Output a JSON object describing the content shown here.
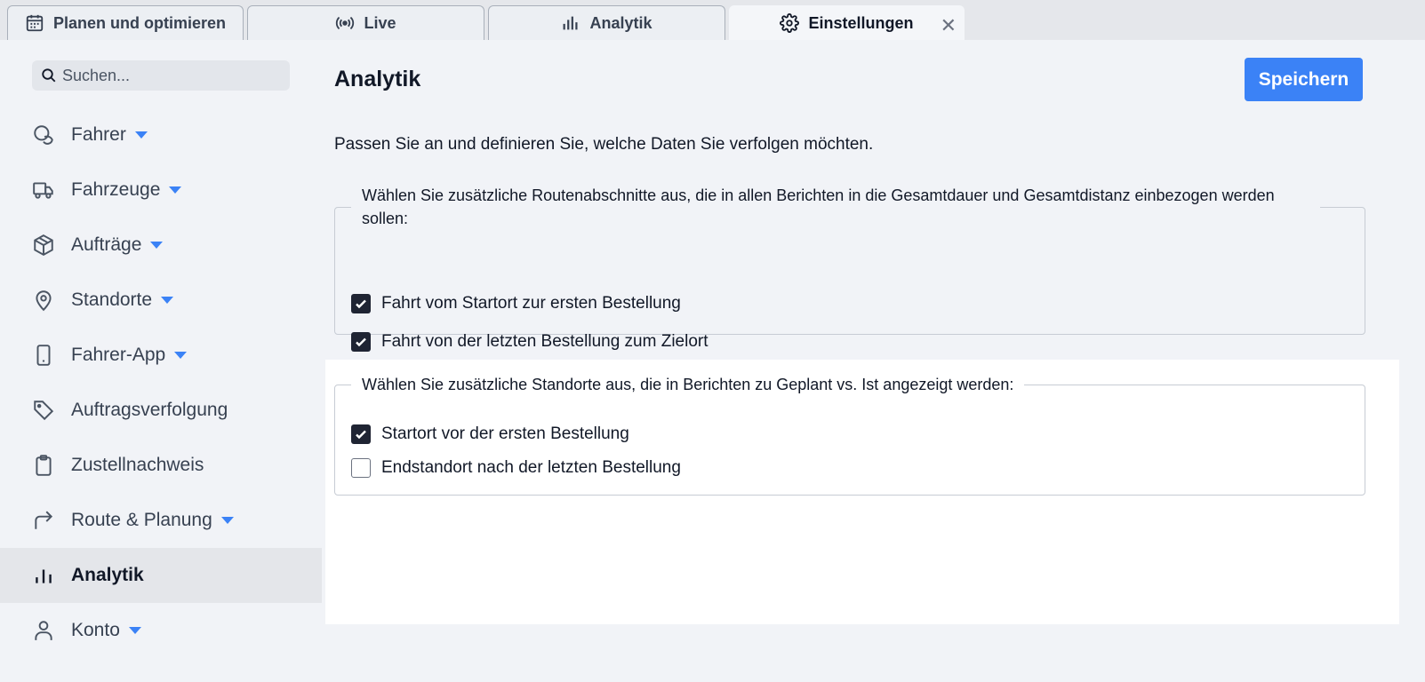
{
  "tabs": [
    {
      "label": "Planen und optimieren",
      "icon": "calendar-icon"
    },
    {
      "label": "Live",
      "icon": "broadcast-icon"
    },
    {
      "label": "Analytik",
      "icon": "bar-chart-icon"
    },
    {
      "label": "Einstellungen",
      "icon": "gear-icon",
      "active": true,
      "close": "✕"
    }
  ],
  "search": {
    "placeholder": "Suchen..."
  },
  "sidebar": {
    "items": [
      {
        "label": "Fahrer",
        "icon": "drivers-icon",
        "expandable": true
      },
      {
        "label": "Fahrzeuge",
        "icon": "truck-icon",
        "expandable": true
      },
      {
        "label": "Aufträge",
        "icon": "package-icon",
        "expandable": true
      },
      {
        "label": "Standorte",
        "icon": "location-pin-icon",
        "expandable": true
      },
      {
        "label": "Fahrer-App",
        "icon": "smartphone-icon",
        "expandable": true
      },
      {
        "label": "Auftragsverfolgung",
        "icon": "tag-icon",
        "expandable": false
      },
      {
        "label": "Zustellnachweis",
        "icon": "clipboard-icon",
        "expandable": false
      },
      {
        "label": "Route & Planung",
        "icon": "route-arrow-icon",
        "expandable": true
      },
      {
        "label": "Analytik",
        "icon": "analytics-icon",
        "expandable": false,
        "active": true
      },
      {
        "label": "Konto",
        "icon": "user-icon",
        "expandable": true
      }
    ]
  },
  "main": {
    "title": "Analytik",
    "save_label": "Speichern",
    "description": "Passen Sie an und definieren Sie, welche Daten Sie verfolgen möchten.",
    "groups": [
      {
        "legend": "Wählen Sie zusätzliche Routenabschnitte aus, die in allen Berichten in die Gesamtdauer und Gesamtdistanz einbezogen werden sollen:",
        "options": [
          {
            "label": "Fahrt vom Startort zur ersten Bestellung",
            "checked": true
          },
          {
            "label": "Fahrt von der letzten Bestellung zum Zielort",
            "checked": true
          }
        ]
      },
      {
        "legend": "Wählen Sie zusätzliche Standorte aus, die in Berichten zu Geplant vs. Ist angezeigt werden:",
        "options": [
          {
            "label": "Startort vor der ersten Bestellung",
            "checked": true
          },
          {
            "label": "Endstandort nach der letzten Bestellung",
            "checked": false
          }
        ]
      }
    ]
  },
  "colors": {
    "accent": "#3b82f6",
    "checkbox_on": "#1f2433",
    "sidebar_active": "#e4e6ea"
  }
}
